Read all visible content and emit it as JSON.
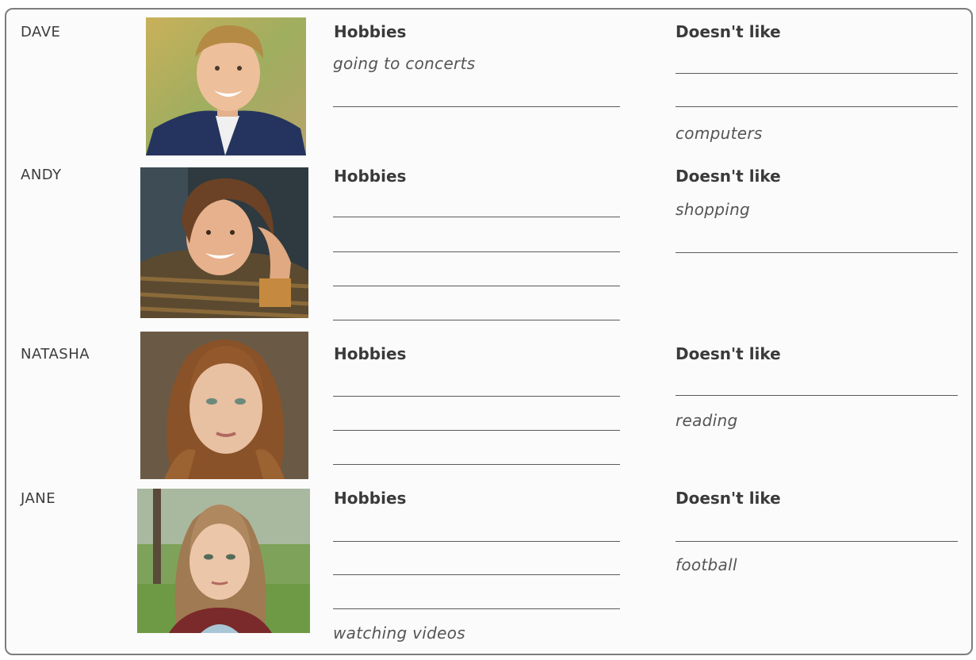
{
  "labels": {
    "hobbies": "Hobbies",
    "doesnt_like": "Doesn't like"
  },
  "people": [
    {
      "name": "DAVE",
      "hobby_answer": "going to concerts",
      "dislike_answer": "computers"
    },
    {
      "name": "ANDY",
      "dislike_answer": "shopping"
    },
    {
      "name": "NATASHA",
      "dislike_answer": "reading"
    },
    {
      "name": "JANE",
      "hobby_answer": "watching videos",
      "dislike_answer": "football"
    }
  ]
}
